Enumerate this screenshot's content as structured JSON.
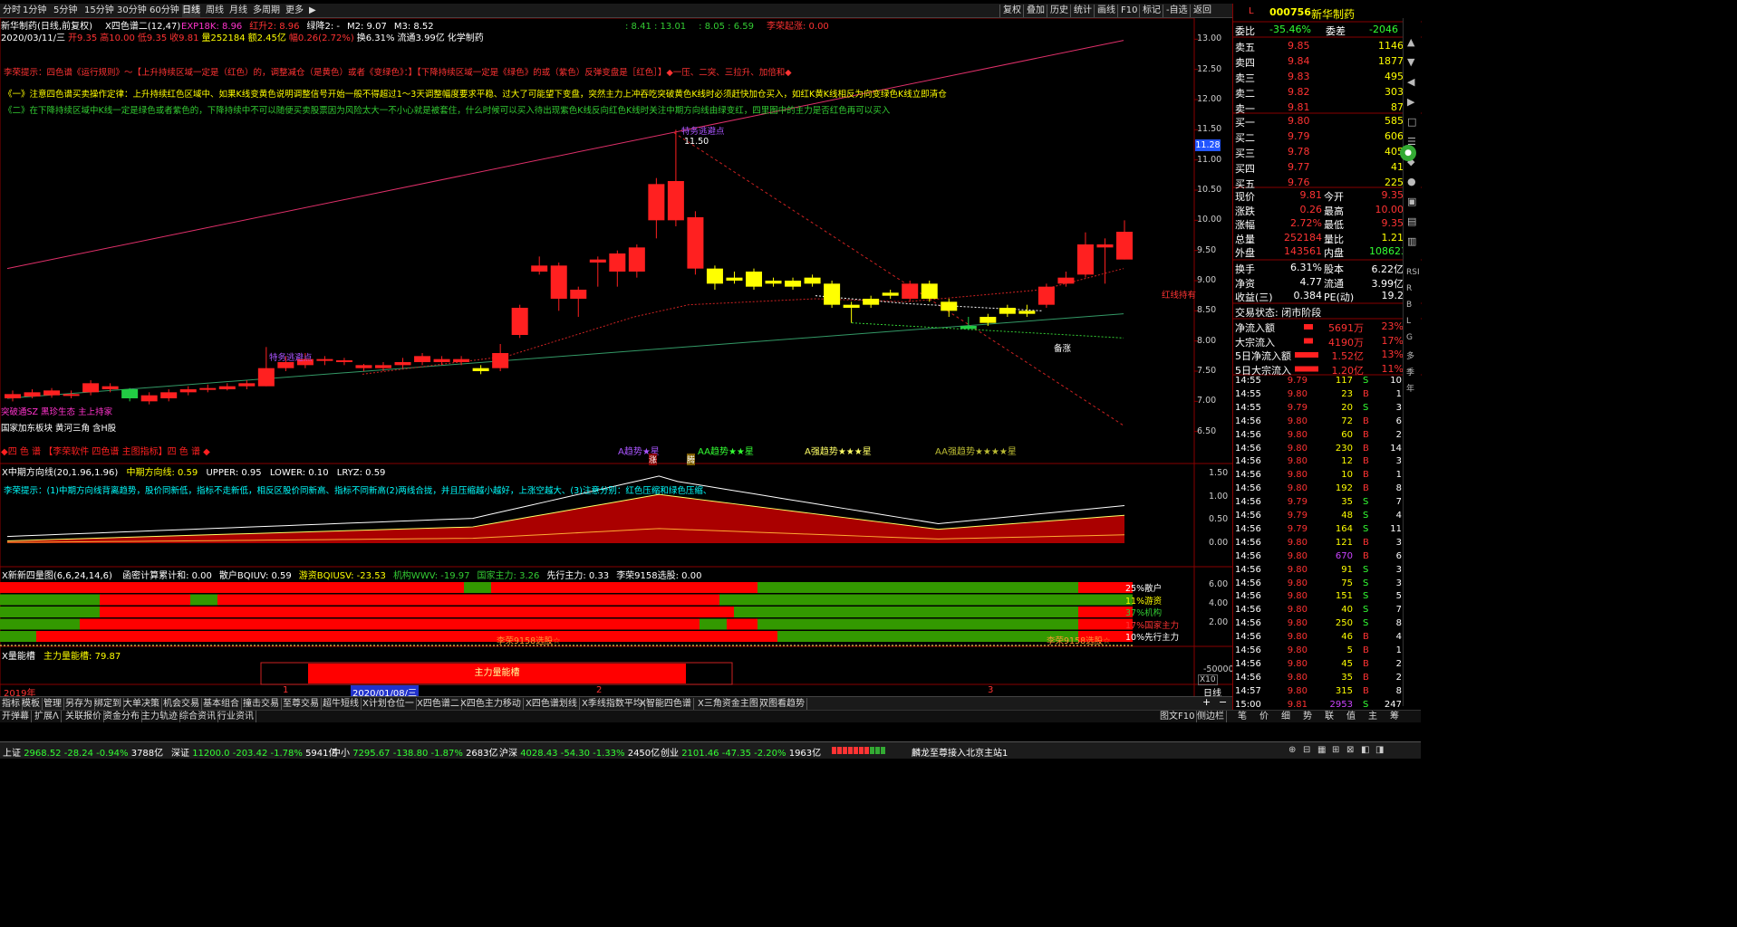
{
  "colors": {
    "up": "#ff2020",
    "down": "#22cc44",
    "yellow": "#ffff00",
    "cyan": "#00ffff",
    "magenta": "#ff33cc",
    "grid": "#800000"
  },
  "top": {
    "periods": [
      "分时",
      "1分钟",
      "5分钟",
      "15分钟",
      "30分钟",
      "60分钟",
      "日线",
      "周线",
      "月线",
      "多周期",
      "更多"
    ],
    "active_period": "日线",
    "tools": [
      "复权",
      "叠加",
      "历史",
      "统计",
      "画线",
      "F10",
      "标记",
      "-自选",
      "返回"
    ]
  },
  "chart": {
    "title": "新华制药(日线,前复权)",
    "indicator": "X四色谱二(12,47)",
    "params": [
      {
        "t": "EXP18K: 8.96",
        "c": "#ff33cc"
      },
      {
        "t": "红升2: 8.96",
        "c": "#ff3333"
      },
      {
        "t": "绿降2: -",
        "c": "#ffffff"
      },
      {
        "t": "M2: 9.07",
        "c": "#ffffff"
      },
      {
        "t": "M3: 8.52",
        "c": "#ffffff"
      }
    ],
    "params2": [
      {
        "t": ": 8.41 : 13.01",
        "c": "#33cc33"
      },
      {
        "t": ": 8.05 : 6.59",
        "c": "#33cc33"
      },
      {
        "t": "李荣起涨: 0.00",
        "c": "#ff3333"
      }
    ],
    "bar_info": {
      "date": "2020/03/11/三",
      "open": "开9.35",
      "high": "高10.00",
      "low": "低9.35",
      "close": "收9.81",
      "vol": "量252184",
      "amt": "额2.45亿",
      "chg": "幅0.26(2.72%)",
      "turn": "换6.31%",
      "float": "流通3.99亿",
      "concept": "化学制药"
    },
    "hint1": "李荣提示：四色谱《运行规则》～【上升持续区域一定是（红色）的，调整减仓（是黄色）或者《变绿色》：】【下降持续区域一定是《绿色》的或（紫色）反弹变盘是［红色］】◆一压、二突、三拉升、加倍和◆",
    "hint2": "《一》注意四色谱买卖操作定律：上升持续红色区域中、如果K线变黄色说明调整信号开始一般不得超过1～3天调整幅度要求平稳、过大了可能望下变盘，突然主力上冲吞吃突破黄色K线时必须赶快加仓买入，如红K黄K线相反为向变绿色K线立即清仓",
    "hint3": "《二》在下降持续区域中K线一定是绿色或者紫色的，下降持续中不可以随便买卖股票因为风险太大一不小心就是被套住，什么时候可以买入待出现紫色K线反向红色K线时关注中期方向线由绿变红，四里图中的主力是否红色再可以买入",
    "annot": {
      "escape1": "特务逃避点",
      "escape2": "特务逃避点",
      "high_val": "11.50",
      "price_tag": "11.28",
      "jiqi": "备涨",
      "redline": "红线持有",
      "zhang": "涨",
      "teng": "腾"
    },
    "trend_labels": [
      "A趋势★星",
      "AA趋势★★星",
      "A强趋势★★★星",
      "AA强趋势★★★★星"
    ],
    "left_notes": [
      "突破通SZ 黑珍生态 主上持家",
      "国家加东板块 黄河三角 含H股"
    ],
    "bottom_label": "◆四 色 谱 【李荣软件 四色谱 主图指标】四 色 谱 ◆",
    "yticks": [
      "13.00",
      "12.50",
      "12.00",
      "11.50",
      "11.00",
      "10.50",
      "10.00",
      "9.50",
      "9.00",
      "8.50",
      "8.00",
      "7.50",
      "7.00",
      "6.50"
    ]
  },
  "chart_data": {
    "type": "candlestick",
    "title": "新华制药(日线,前复权)",
    "ylim": [
      6.3,
      13.2
    ],
    "candles": [
      {
        "o": 7.05,
        "c": 7.12,
        "h": 7.18,
        "l": 7.0,
        "k": "r"
      },
      {
        "o": 7.08,
        "c": 7.15,
        "h": 7.2,
        "l": 7.05,
        "k": "r"
      },
      {
        "o": 7.1,
        "c": 7.18,
        "h": 7.22,
        "l": 7.06,
        "k": "r"
      },
      {
        "o": 7.12,
        "c": 7.1,
        "h": 7.18,
        "l": 7.05,
        "k": "r"
      },
      {
        "o": 7.15,
        "c": 7.3,
        "h": 7.35,
        "l": 7.1,
        "k": "r"
      },
      {
        "o": 7.25,
        "c": 7.2,
        "h": 7.3,
        "l": 7.15,
        "k": "r"
      },
      {
        "o": 7.2,
        "c": 7.05,
        "h": 7.22,
        "l": 7.0,
        "k": "g"
      },
      {
        "o": 7.1,
        "c": 7.0,
        "h": 7.15,
        "l": 6.95,
        "k": "r"
      },
      {
        "o": 7.05,
        "c": 7.15,
        "h": 7.2,
        "l": 7.0,
        "k": "r"
      },
      {
        "o": 7.15,
        "c": 7.2,
        "h": 7.25,
        "l": 7.1,
        "k": "r"
      },
      {
        "o": 7.2,
        "c": 7.22,
        "h": 7.28,
        "l": 7.15,
        "k": "r"
      },
      {
        "o": 7.2,
        "c": 7.25,
        "h": 7.3,
        "l": 7.18,
        "k": "r"
      },
      {
        "o": 7.25,
        "c": 7.3,
        "h": 7.35,
        "l": 7.2,
        "k": "r"
      },
      {
        "o": 7.25,
        "c": 7.55,
        "h": 7.9,
        "l": 7.25,
        "k": "r"
      },
      {
        "o": 7.55,
        "c": 7.65,
        "h": 7.75,
        "l": 7.5,
        "k": "r"
      },
      {
        "o": 7.6,
        "c": 7.7,
        "h": 7.8,
        "l": 7.55,
        "k": "r"
      },
      {
        "o": 7.68,
        "c": 7.7,
        "h": 7.75,
        "l": 7.6,
        "k": "r"
      },
      {
        "o": 7.65,
        "c": 7.68,
        "h": 7.72,
        "l": 7.6,
        "k": "r"
      },
      {
        "o": 7.6,
        "c": 7.55,
        "h": 7.62,
        "l": 7.5,
        "k": "r"
      },
      {
        "o": 7.55,
        "c": 7.6,
        "h": 7.65,
        "l": 7.5,
        "k": "r"
      },
      {
        "o": 7.6,
        "c": 7.65,
        "h": 7.72,
        "l": 7.55,
        "k": "r"
      },
      {
        "o": 7.65,
        "c": 7.75,
        "h": 7.8,
        "l": 7.6,
        "k": "r"
      },
      {
        "o": 7.7,
        "c": 7.65,
        "h": 7.75,
        "l": 7.6,
        "k": "r"
      },
      {
        "o": 7.65,
        "c": 7.7,
        "h": 7.75,
        "l": 7.6,
        "k": "r"
      },
      {
        "o": 7.55,
        "c": 7.5,
        "h": 7.6,
        "l": 7.45,
        "k": "y"
      },
      {
        "o": 7.55,
        "c": 7.8,
        "h": 7.95,
        "l": 7.5,
        "k": "r"
      },
      {
        "o": 8.1,
        "c": 8.55,
        "h": 8.6,
        "l": 8.05,
        "k": "r"
      },
      {
        "o": 9.15,
        "c": 9.25,
        "h": 9.4,
        "l": 9.1,
        "k": "r"
      },
      {
        "o": 9.25,
        "c": 8.7,
        "h": 9.3,
        "l": 8.5,
        "k": "r"
      },
      {
        "o": 8.85,
        "c": 8.7,
        "h": 8.9,
        "l": 8.4,
        "k": "r"
      },
      {
        "o": 9.3,
        "c": 9.35,
        "h": 9.4,
        "l": 8.9,
        "k": "r"
      },
      {
        "o": 9.45,
        "c": 9.15,
        "h": 9.5,
        "l": 8.9,
        "k": "r"
      },
      {
        "o": 9.15,
        "c": 9.55,
        "h": 9.6,
        "l": 9.05,
        "k": "r"
      },
      {
        "o": 10.0,
        "c": 10.6,
        "h": 10.7,
        "l": 9.7,
        "k": "r"
      },
      {
        "o": 10.0,
        "c": 10.65,
        "h": 11.5,
        "l": 9.9,
        "k": "r"
      },
      {
        "o": 10.05,
        "c": 9.2,
        "h": 10.15,
        "l": 9.1,
        "k": "r"
      },
      {
        "o": 9.2,
        "c": 8.95,
        "h": 9.25,
        "l": 8.85,
        "k": "y"
      },
      {
        "o": 9.05,
        "c": 9.0,
        "h": 9.15,
        "l": 8.95,
        "k": "y"
      },
      {
        "o": 9.15,
        "c": 8.9,
        "h": 9.2,
        "l": 8.85,
        "k": "y"
      },
      {
        "o": 9.0,
        "c": 8.95,
        "h": 9.05,
        "l": 8.9,
        "k": "y"
      },
      {
        "o": 9.0,
        "c": 8.9,
        "h": 9.05,
        "l": 8.85,
        "k": "y"
      },
      {
        "o": 9.05,
        "c": 8.95,
        "h": 9.1,
        "l": 8.9,
        "k": "y"
      },
      {
        "o": 8.95,
        "c": 8.6,
        "h": 9.0,
        "l": 8.55,
        "k": "y"
      },
      {
        "o": 8.6,
        "c": 8.55,
        "h": 8.65,
        "l": 8.3,
        "k": "y"
      },
      {
        "o": 8.6,
        "c": 8.7,
        "h": 8.75,
        "l": 8.55,
        "k": "y"
      },
      {
        "o": 8.8,
        "c": 8.75,
        "h": 8.85,
        "l": 8.7,
        "k": "y"
      },
      {
        "o": 8.7,
        "c": 8.95,
        "h": 9.0,
        "l": 8.65,
        "k": "r"
      },
      {
        "o": 8.95,
        "c": 8.7,
        "h": 9.0,
        "l": 8.65,
        "k": "y"
      },
      {
        "o": 8.65,
        "c": 8.5,
        "h": 8.7,
        "l": 8.4,
        "k": "y"
      },
      {
        "o": 8.25,
        "c": 8.2,
        "h": 8.4,
        "l": 8.18,
        "k": "g"
      },
      {
        "o": 8.3,
        "c": 8.4,
        "h": 8.45,
        "l": 8.25,
        "k": "y"
      },
      {
        "o": 8.45,
        "c": 8.55,
        "h": 8.6,
        "l": 8.4,
        "k": "y"
      },
      {
        "o": 8.5,
        "c": 8.45,
        "h": 8.6,
        "l": 8.4,
        "k": "y"
      },
      {
        "o": 8.6,
        "c": 8.9,
        "h": 8.95,
        "l": 8.55,
        "k": "r"
      },
      {
        "o": 8.95,
        "c": 9.05,
        "h": 9.15,
        "l": 8.9,
        "k": "r"
      },
      {
        "o": 9.1,
        "c": 9.6,
        "h": 9.8,
        "l": 9.05,
        "k": "r"
      },
      {
        "o": 9.6,
        "c": 9.55,
        "h": 9.7,
        "l": 8.95,
        "k": "r"
      },
      {
        "o": 9.35,
        "c": 9.81,
        "h": 10.0,
        "l": 9.35,
        "k": "r"
      }
    ]
  },
  "sub1": {
    "title": "X中期方向线(20,1.96,1.96)",
    "line": "中期方向线: 0.59",
    "upper": "UPPER: 0.95",
    "lower": "LOWER: 0.10",
    "lryz": "LRYZ: 0.59",
    "hint": "李荣提示：(1)中期方向线背离趋势，股价同新低，指标不走新低，相反区股价同新高、指标不同新高(2)两线合拢，并且压缩越小越好，上涨空越大、(3)注意分别：红色压缩和绿色压缩、",
    "yticks": [
      "1.50",
      "1.00",
      "0.50",
      "0.00"
    ]
  },
  "sub2": {
    "title": "X新新四量图(6,6,24,14,6)",
    "items": [
      {
        "t": "函密计算累计和: 0.00",
        "c": "#ffffff"
      },
      {
        "t": "散户BQIUV: 0.59",
        "c": "#ffffff"
      },
      {
        "t": "游资BQIUSV: -23.53",
        "c": "#ffff00"
      },
      {
        "t": "机构WWV: -19.97",
        "c": "#33cc33"
      },
      {
        "t": "国家主力: 3.26",
        "c": "#33cc33"
      },
      {
        "t": "先行主力: 0.33",
        "c": "#ffffff"
      },
      {
        "t": "李荣9158选股: 0.00",
        "c": "#ffffff"
      }
    ],
    "row_labels": [
      "25%散户",
      "11%游资",
      "37%机构",
      "17%国家主力",
      "10%先行主力"
    ],
    "select1": "李荣9158选股☆",
    "select2": "李荣9158选股☆",
    "yticks": [
      "6.00",
      "4.00",
      "2.00"
    ]
  },
  "sub3": {
    "title": "X量能槽",
    "value": "主力量能槽: 79.87",
    "box": "主力量能槽",
    "ytick": "-50000",
    "x10": "X10"
  },
  "xaxis": {
    "year": "2019年",
    "date": "2020/01/08/三",
    "m1": "1",
    "m2": "2",
    "m3": "3",
    "period_btn": "日线"
  },
  "bottom_tabs": [
    "指标",
    "模板",
    "管理",
    "另存为",
    "绑定到",
    "大单决策",
    "机会交易",
    "基本组合",
    "撞击交易",
    "至尊交易",
    "超牛短线",
    "X计划仓位一",
    "X四色谱二",
    "X四色主力移动",
    "X四色谱划线",
    "X季线指数平均",
    "X智能四色谱",
    "X三角资金主图",
    "双图看趋势"
  ],
  "func_bar": [
    "开弹幕",
    "扩展ᐱ",
    "关联报价",
    "资金分布",
    "主力轨迹",
    "综合资讯",
    "行业资讯"
  ],
  "func_right": [
    "图文F10",
    "侧边栏"
  ],
  "right_tabs": [
    "笔",
    "价",
    "细",
    "势",
    "联",
    "值",
    "主",
    "筹"
  ],
  "rp": {
    "code": "000756",
    "name": "新华制药",
    "l_mark": "L",
    "weibi": {
      "label": "委比",
      "val": "-35.46%",
      "label2": "委差",
      "val2": "-2046"
    },
    "sells": [
      [
        "卖五",
        "9.85",
        "1146"
      ],
      [
        "卖四",
        "9.84",
        "1877"
      ],
      [
        "卖三",
        "9.83",
        "495"
      ],
      [
        "卖二",
        "9.82",
        "303"
      ],
      [
        "卖一",
        "9.81",
        "87"
      ]
    ],
    "buys": [
      [
        "买一",
        "9.80",
        "585"
      ],
      [
        "买二",
        "9.79",
        "606"
      ],
      [
        "买三",
        "9.78",
        "405"
      ],
      [
        "买四",
        "9.77",
        "41"
      ],
      [
        "买五",
        "9.76",
        "225"
      ]
    ],
    "quote": [
      [
        "现价",
        "9.81",
        "今开",
        "9.35"
      ],
      [
        "涨跌",
        "0.26",
        "最高",
        "10.00"
      ],
      [
        "涨幅",
        "2.72%",
        "最低",
        "9.35"
      ],
      [
        "总量",
        "252184",
        "量比",
        "1.21"
      ],
      [
        "外盘",
        "143561",
        "内盘",
        "108623"
      ]
    ],
    "fund": [
      [
        "换手",
        "6.31%",
        "股本",
        "6.22亿"
      ],
      [
        "净资",
        "4.77",
        "流通",
        "3.99亿"
      ],
      [
        "收益(三)",
        "0.384",
        "PE(动)",
        "19.2"
      ]
    ],
    "state": "交易状态: 闭市阶段",
    "flows": [
      [
        "净流入额",
        "5691万",
        "23%"
      ],
      [
        "大宗流入",
        "4190万",
        "17%"
      ],
      [
        "5日净流入额",
        "1.52亿",
        "13%"
      ],
      [
        "5日大宗流入",
        "1.20亿",
        "11%"
      ]
    ],
    "ticks": [
      [
        "14:55",
        "9.79",
        "117",
        "S",
        "10"
      ],
      [
        "14:55",
        "9.80",
        "23",
        "B",
        "1"
      ],
      [
        "14:55",
        "9.79",
        "20",
        "S",
        "3"
      ],
      [
        "14:56",
        "9.80",
        "72",
        "B",
        "6"
      ],
      [
        "14:56",
        "9.80",
        "60",
        "B",
        "2"
      ],
      [
        "14:56",
        "9.80",
        "230",
        "B",
        "14"
      ],
      [
        "14:56",
        "9.80",
        "12",
        "B",
        "3"
      ],
      [
        "14:56",
        "9.80",
        "10",
        "B",
        "1"
      ],
      [
        "14:56",
        "9.80",
        "192",
        "B",
        "8"
      ],
      [
        "14:56",
        "9.79",
        "35",
        "S",
        "7"
      ],
      [
        "14:56",
        "9.79",
        "48",
        "S",
        "4"
      ],
      [
        "14:56",
        "9.79",
        "164",
        "S",
        "11"
      ],
      [
        "14:56",
        "9.80",
        "121",
        "B",
        "3"
      ],
      [
        "14:56",
        "9.80",
        "670",
        "B",
        "6"
      ],
      [
        "14:56",
        "9.80",
        "91",
        "S",
        "3"
      ],
      [
        "14:56",
        "9.80",
        "75",
        "S",
        "3"
      ],
      [
        "14:56",
        "9.80",
        "151",
        "S",
        "5"
      ],
      [
        "14:56",
        "9.80",
        "40",
        "S",
        "7"
      ],
      [
        "14:56",
        "9.80",
        "250",
        "S",
        "8"
      ],
      [
        "14:56",
        "9.80",
        "46",
        "B",
        "4"
      ],
      [
        "14:56",
        "9.80",
        "5",
        "B",
        "1"
      ],
      [
        "14:56",
        "9.80",
        "45",
        "B",
        "2"
      ],
      [
        "14:56",
        "9.80",
        "35",
        "B",
        "2"
      ],
      [
        "14:57",
        "9.80",
        "315",
        "B",
        "8"
      ],
      [
        "15:00",
        "9.81",
        "2953",
        "S",
        "247"
      ]
    ]
  },
  "ticker": {
    "items": [
      {
        "n": "上证",
        "v": "2968.52",
        "d": "-28.24",
        "p": "-0.94%",
        "a": "3788亿"
      },
      {
        "n": "深证",
        "v": "11200.0",
        "d": "-203.42",
        "p": "-1.78%",
        "a": "5941亿"
      },
      {
        "n": "中小",
        "v": "7295.67",
        "d": "-138.80",
        "p": "-1.87%",
        "a": "2683亿"
      },
      {
        "n": "沪深",
        "v": "4028.43",
        "d": "-54.30",
        "p": "-1.33%",
        "a": "2450亿"
      },
      {
        "n": "创业",
        "v": "2101.46",
        "d": "-47.35",
        "p": "-2.20%",
        "a": "1963亿"
      }
    ],
    "server": "麟龙至尊接入北京主站1"
  },
  "scroll_letters": [
    "RSI",
    "R",
    "B",
    "L",
    "G",
    "多",
    "季",
    "年"
  ]
}
